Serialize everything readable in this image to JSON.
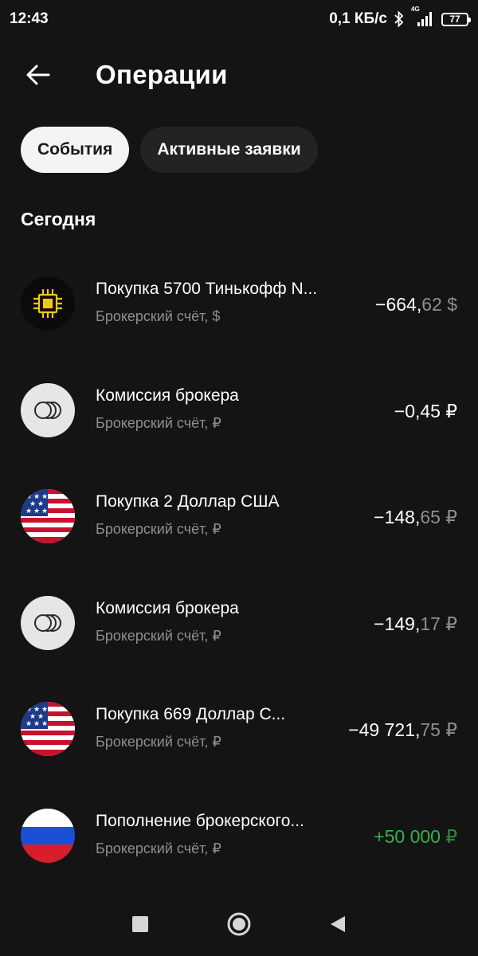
{
  "status": {
    "time": "12:43",
    "speed": "0,1 КБ/с",
    "network": "4G",
    "battery": "77"
  },
  "header": {
    "title": "Операции"
  },
  "tabs": [
    {
      "label": "События",
      "active": true
    },
    {
      "label": "Активные заявки",
      "active": false
    }
  ],
  "section": {
    "title": "Сегодня"
  },
  "operations": [
    {
      "title": "Покупка 5700 Тинькофф N...",
      "subtitle": "Брокерский счёт, $",
      "amount_int": "−664,",
      "amount_frac": "62",
      "currency": " $",
      "icon": "chip-icon"
    },
    {
      "title": "Комиссия брокера",
      "subtitle": "Брокерский счёт, ₽",
      "amount_int": "−0,45",
      "amount_frac": "",
      "currency": " ₽",
      "icon": "coins-icon"
    },
    {
      "title": "Покупка 2 Доллар США",
      "subtitle": "Брокерский счёт, ₽",
      "amount_int": "−148,",
      "amount_frac": "65",
      "currency": " ₽",
      "icon": "us-flag-icon"
    },
    {
      "title": "Комиссия брокера",
      "subtitle": "Брокерский счёт, ₽",
      "amount_int": "−149,",
      "amount_frac": "17",
      "currency": " ₽",
      "icon": "coins-icon"
    },
    {
      "title": "Покупка 669 Доллар С...",
      "subtitle": "Брокерский счёт, ₽",
      "amount_int": "−49 721,",
      "amount_frac": "75",
      "currency": " ₽",
      "icon": "us-flag-icon"
    },
    {
      "title": "Пополнение брокерского...",
      "subtitle": "Брокерский счёт, ₽",
      "amount_int": "+50 000",
      "amount_frac": "",
      "currency": " ₽",
      "icon": "ru-flag-icon",
      "positive": true
    }
  ],
  "colors": {
    "background": "#141414",
    "positive": "#33b249",
    "muted": "#8e8e93"
  }
}
